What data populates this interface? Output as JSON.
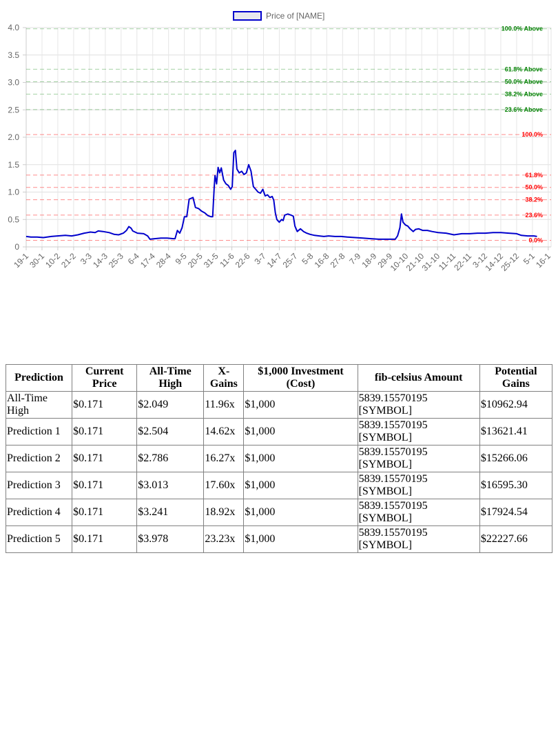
{
  "chart_data": {
    "type": "line",
    "series": [
      {
        "name": "Price of [NAME]",
        "color": "#0000cc",
        "values": [
          [
            0,
            0.19
          ],
          [
            6,
            0.18
          ],
          [
            14,
            0.18
          ],
          [
            22,
            0.17
          ],
          [
            32,
            0.19
          ],
          [
            40,
            0.2
          ],
          [
            50,
            0.21
          ],
          [
            58,
            0.2
          ],
          [
            66,
            0.22
          ],
          [
            74,
            0.25
          ],
          [
            82,
            0.27
          ],
          [
            88,
            0.26
          ],
          [
            92,
            0.29
          ],
          [
            98,
            0.28
          ],
          [
            106,
            0.26
          ],
          [
            112,
            0.23
          ],
          [
            118,
            0.22
          ],
          [
            124,
            0.25
          ],
          [
            128,
            0.3
          ],
          [
            131,
            0.37
          ],
          [
            134,
            0.34
          ],
          [
            136,
            0.29
          ],
          [
            142,
            0.25
          ],
          [
            150,
            0.24
          ],
          [
            155,
            0.2
          ],
          [
            158,
            0.14
          ],
          [
            164,
            0.15
          ],
          [
            172,
            0.16
          ],
          [
            180,
            0.16
          ],
          [
            188,
            0.15
          ],
          [
            190,
            0.15
          ],
          [
            193,
            0.3
          ],
          [
            196,
            0.25
          ],
          [
            199,
            0.35
          ],
          [
            202,
            0.55
          ],
          [
            205,
            0.55
          ],
          [
            208,
            0.87
          ],
          [
            213,
            0.9
          ],
          [
            216,
            0.72
          ],
          [
            220,
            0.7
          ],
          [
            224,
            0.65
          ],
          [
            228,
            0.62
          ],
          [
            232,
            0.57
          ],
          [
            236,
            0.55
          ],
          [
            238,
            0.55
          ],
          [
            240,
            1.1
          ],
          [
            241,
            1.3
          ],
          [
            243,
            1.15
          ],
          [
            245,
            1.45
          ],
          [
            247,
            1.35
          ],
          [
            249,
            1.44
          ],
          [
            252,
            1.22
          ],
          [
            255,
            1.15
          ],
          [
            258,
            1.12
          ],
          [
            261,
            1.05
          ],
          [
            263,
            1.1
          ],
          [
            265,
            1.72
          ],
          [
            267,
            1.76
          ],
          [
            269,
            1.42
          ],
          [
            272,
            1.35
          ],
          [
            275,
            1.38
          ],
          [
            278,
            1.32
          ],
          [
            281,
            1.35
          ],
          [
            284,
            1.5
          ],
          [
            287,
            1.38
          ],
          [
            290,
            1.1
          ],
          [
            293,
            1.05
          ],
          [
            296,
            1.0
          ],
          [
            299,
            0.98
          ],
          [
            302,
            1.05
          ],
          [
            305,
            0.93
          ],
          [
            308,
            0.95
          ],
          [
            311,
            0.9
          ],
          [
            314,
            0.92
          ],
          [
            316,
            0.85
          ],
          [
            318,
            0.62
          ],
          [
            320,
            0.5
          ],
          [
            323,
            0.45
          ],
          [
            326,
            0.5
          ],
          [
            328,
            0.48
          ],
          [
            330,
            0.58
          ],
          [
            334,
            0.6
          ],
          [
            338,
            0.58
          ],
          [
            341,
            0.56
          ],
          [
            343,
            0.38
          ],
          [
            346,
            0.28
          ],
          [
            350,
            0.33
          ],
          [
            354,
            0.28
          ],
          [
            358,
            0.25
          ],
          [
            362,
            0.23
          ],
          [
            368,
            0.21
          ],
          [
            374,
            0.2
          ],
          [
            380,
            0.19
          ],
          [
            386,
            0.2
          ],
          [
            394,
            0.19
          ],
          [
            402,
            0.19
          ],
          [
            410,
            0.18
          ],
          [
            420,
            0.17
          ],
          [
            430,
            0.16
          ],
          [
            440,
            0.15
          ],
          [
            450,
            0.14
          ],
          [
            460,
            0.14
          ],
          [
            468,
            0.14
          ],
          [
            471,
            0.14
          ],
          [
            474,
            0.2
          ],
          [
            477,
            0.35
          ],
          [
            479,
            0.6
          ],
          [
            481,
            0.45
          ],
          [
            484,
            0.4
          ],
          [
            487,
            0.38
          ],
          [
            490,
            0.33
          ],
          [
            494,
            0.28
          ],
          [
            497,
            0.32
          ],
          [
            501,
            0.33
          ],
          [
            506,
            0.3
          ],
          [
            512,
            0.3
          ],
          [
            518,
            0.28
          ],
          [
            526,
            0.26
          ],
          [
            536,
            0.25
          ],
          [
            546,
            0.22
          ],
          [
            556,
            0.24
          ],
          [
            566,
            0.24
          ],
          [
            576,
            0.25
          ],
          [
            586,
            0.25
          ],
          [
            596,
            0.26
          ],
          [
            606,
            0.26
          ],
          [
            616,
            0.25
          ],
          [
            626,
            0.24
          ],
          [
            632,
            0.21
          ],
          [
            640,
            0.2
          ],
          [
            648,
            0.2
          ],
          [
            652,
            0.19
          ]
        ]
      }
    ],
    "x_tick_labels": [
      "19-1",
      "30-1",
      "10-2",
      "21-2",
      "3-3",
      "14-3",
      "25-3",
      "6-4",
      "17-4",
      "28-4",
      "9-5",
      "20-5",
      "31-5",
      "11-6",
      "22-6",
      "3-7",
      "14-7",
      "25-7",
      "5-8",
      "16-8",
      "27-8",
      "7-9",
      "18-9",
      "29-9",
      "10-10",
      "21-10",
      "31-10",
      "11-11",
      "22-11",
      "3-12",
      "14-12",
      "25-12",
      "5-1",
      "16-1"
    ],
    "y_ticks": [
      "0",
      "0.5",
      "1.0",
      "1.5",
      "2.0",
      "2.5",
      "3.0",
      "3.5",
      "4.0"
    ],
    "ylim": [
      0,
      4.0
    ],
    "x_range": [
      0,
      670
    ],
    "grid": true,
    "legend_position": "top-center",
    "fib_levels": [
      {
        "label": "100.0% Above",
        "value": 3.978,
        "color": "#008000"
      },
      {
        "label": "61.8% Above",
        "value": 3.241,
        "color": "#008000"
      },
      {
        "label": "50.0% Above",
        "value": 3.013,
        "color": "#008000"
      },
      {
        "label": "38.2% Above",
        "value": 2.786,
        "color": "#008000"
      },
      {
        "label": "23.6% Above",
        "value": 2.504,
        "color": "#008000"
      },
      {
        "label": "100.0%",
        "value": 2.049,
        "color": "#ff0000"
      },
      {
        "label": "61.8%",
        "value": 1.31,
        "color": "#ff0000"
      },
      {
        "label": "50.0%",
        "value": 1.085,
        "color": "#ff0000"
      },
      {
        "label": "38.2%",
        "value": 0.86,
        "color": "#ff0000"
      },
      {
        "label": "23.6%",
        "value": 0.58,
        "color": "#ff0000"
      },
      {
        "label": "0.0%",
        "value": 0.12,
        "color": "#ff0000"
      }
    ]
  },
  "table": {
    "headers": [
      "Prediction",
      "Current Price",
      "All-Time High",
      "X-Gains",
      "$1,000 Investment (Cost)",
      "fib-celsius Amount",
      "Potential Gains"
    ],
    "rows": [
      [
        "All-Time High",
        "$0.171",
        "$2.049",
        "11.96x",
        "$1,000",
        "5839.15570195 [SYMBOL]",
        "$10962.94"
      ],
      [
        "Prediction 1",
        "$0.171",
        "$2.504",
        "14.62x",
        "$1,000",
        "5839.15570195 [SYMBOL]",
        "$13621.41"
      ],
      [
        "Prediction 2",
        "$0.171",
        "$2.786",
        "16.27x",
        "$1,000",
        "5839.15570195 [SYMBOL]",
        "$15266.06"
      ],
      [
        "Prediction 3",
        "$0.171",
        "$3.013",
        "17.60x",
        "$1,000",
        "5839.15570195 [SYMBOL]",
        "$16595.30"
      ],
      [
        "Prediction 4",
        "$0.171",
        "$3.241",
        "18.92x",
        "$1,000",
        "5839.15570195 [SYMBOL]",
        "$17924.54"
      ],
      [
        "Prediction 5",
        "$0.171",
        "$3.978",
        "23.23x",
        "$1,000",
        "5839.15570195 [SYMBOL]",
        "$22227.66"
      ]
    ]
  }
}
